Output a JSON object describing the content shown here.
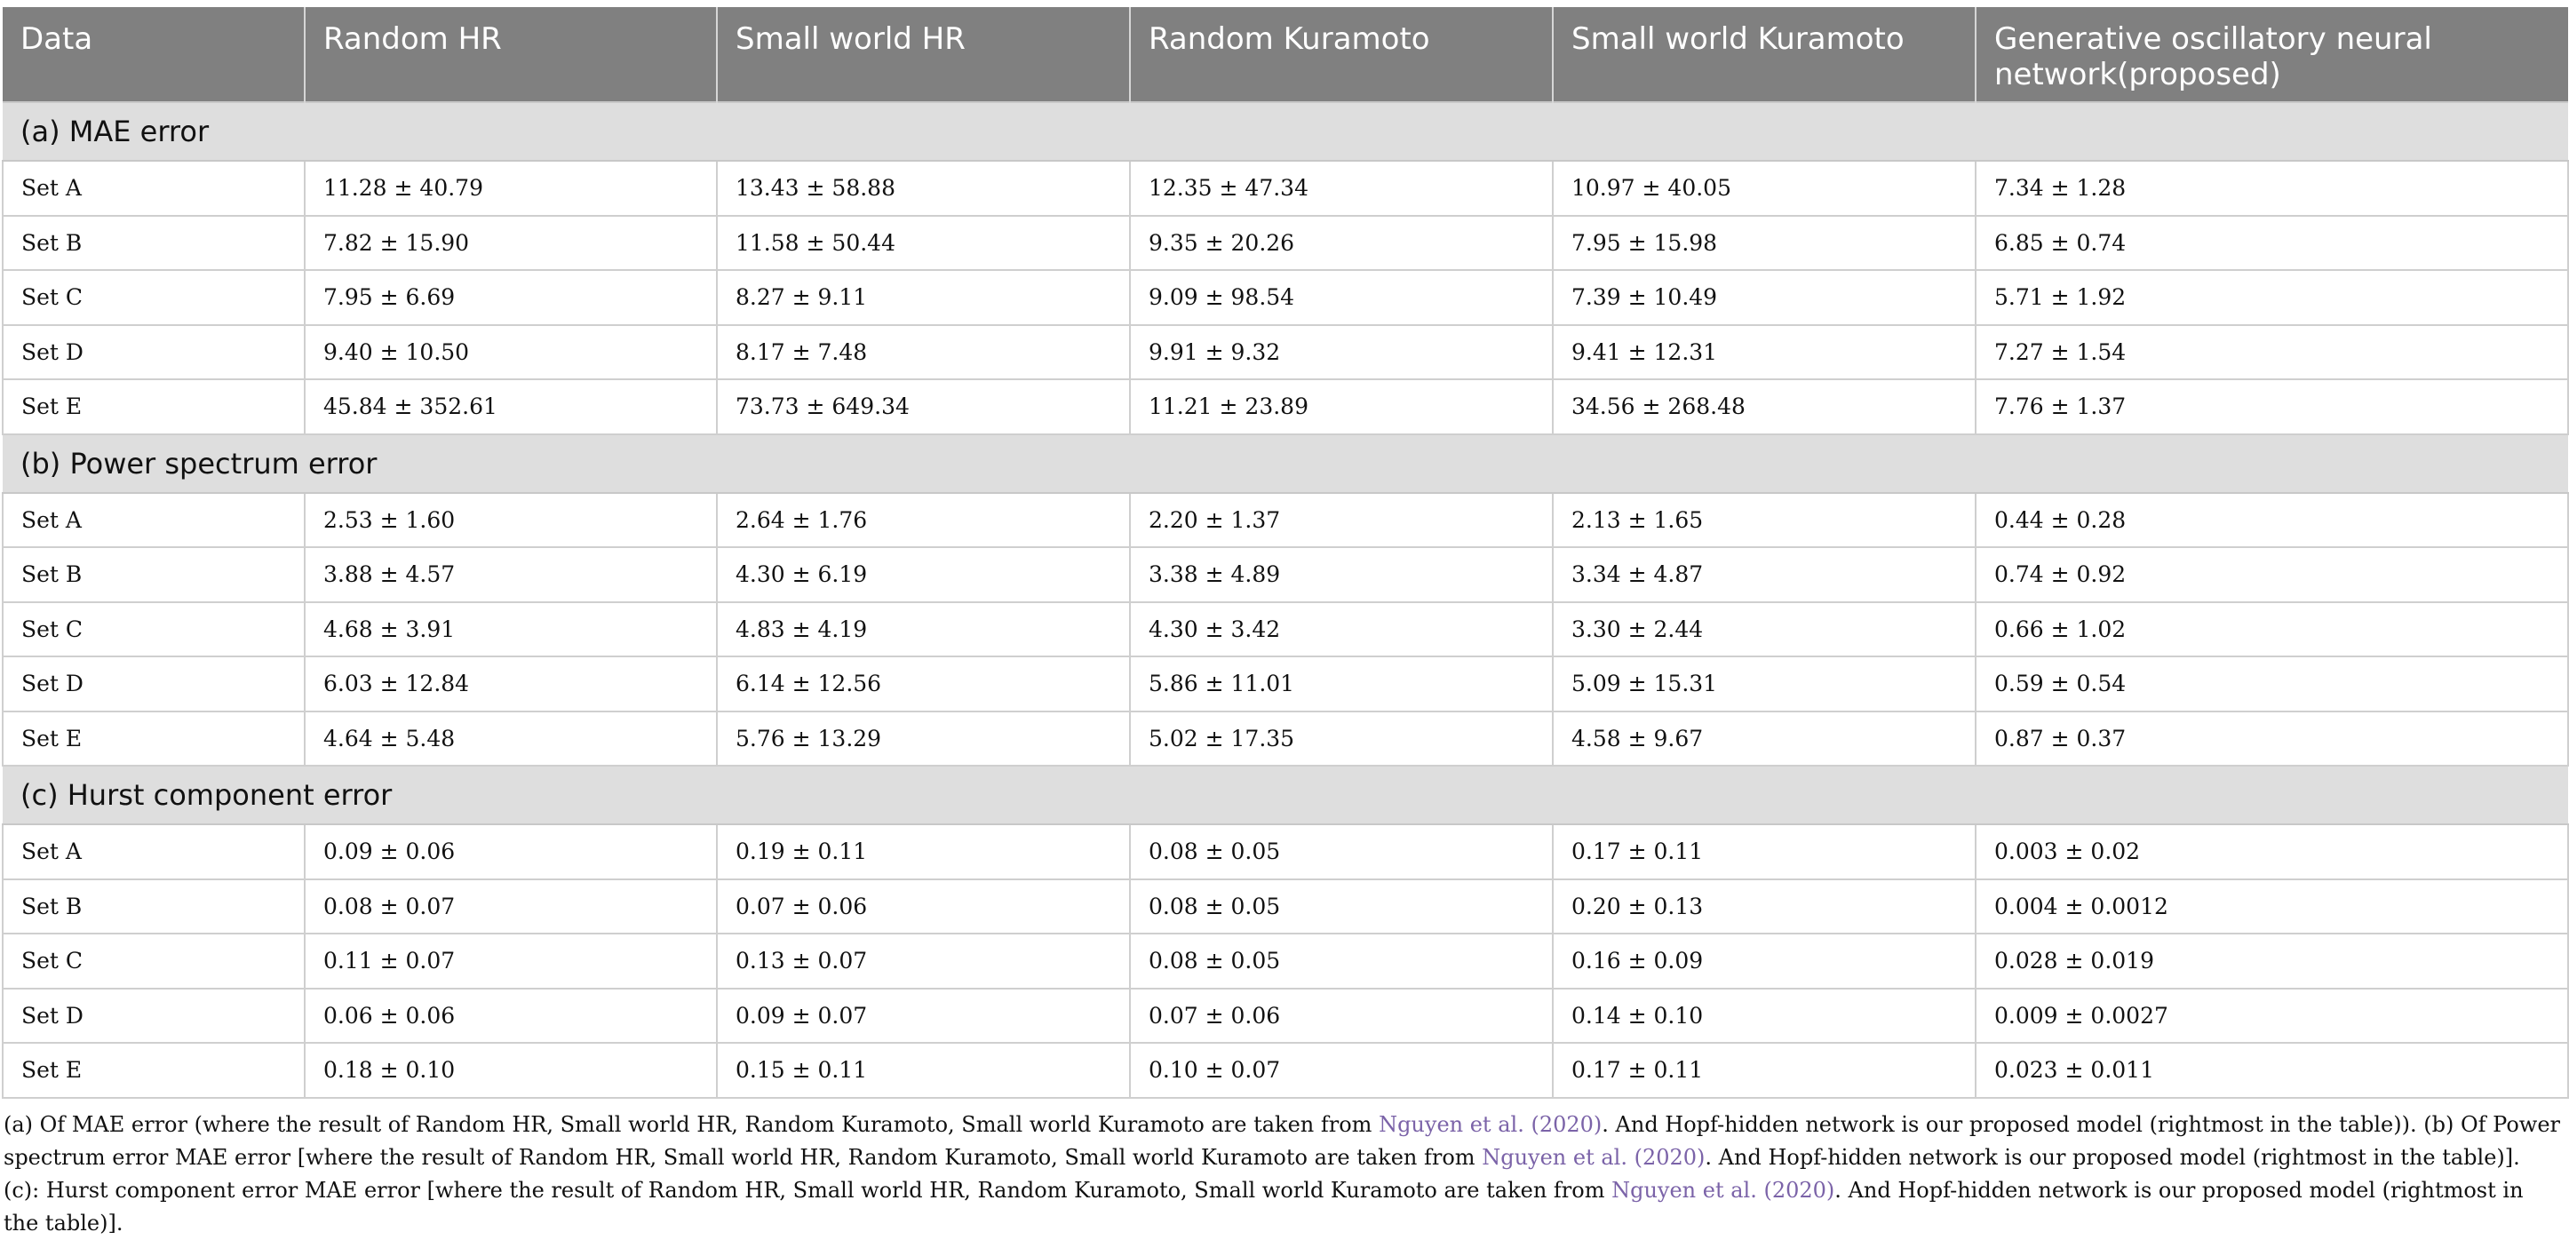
{
  "table": {
    "headers": [
      "Data",
      "Random HR",
      "Small world HR",
      "Random Kuramoto",
      "Small world Kuramoto",
      "Generative oscillatory neural network(proposed)"
    ],
    "sections": [
      {
        "title": "(a) MAE error",
        "rows": [
          [
            "Set A",
            "11.28 ± 40.79",
            "13.43 ± 58.88",
            "12.35 ± 47.34",
            "10.97 ± 40.05",
            "7.34 ± 1.28"
          ],
          [
            "Set B",
            "7.82 ± 15.90",
            "11.58 ± 50.44",
            "9.35 ± 20.26",
            "7.95 ± 15.98",
            "6.85 ± 0.74"
          ],
          [
            "Set C",
            "7.95 ± 6.69",
            "8.27 ± 9.11",
            "9.09 ± 98.54",
            "7.39 ± 10.49",
            "5.71 ± 1.92"
          ],
          [
            "Set D",
            "9.40 ± 10.50",
            "8.17 ± 7.48",
            "9.91 ± 9.32",
            "9.41 ± 12.31",
            "7.27 ± 1.54"
          ],
          [
            "Set E",
            "45.84 ± 352.61",
            "73.73 ± 649.34",
            "11.21 ± 23.89",
            "34.56 ± 268.48",
            "7.76 ± 1.37"
          ]
        ]
      },
      {
        "title": "(b) Power spectrum error",
        "rows": [
          [
            "Set A",
            "2.53 ± 1.60",
            "2.64 ± 1.76",
            "2.20 ± 1.37",
            "2.13 ± 1.65",
            "0.44 ± 0.28"
          ],
          [
            "Set B",
            "3.88 ± 4.57",
            "4.30 ± 6.19",
            "3.38 ± 4.89",
            "3.34 ± 4.87",
            "0.74 ± 0.92"
          ],
          [
            "Set C",
            "4.68 ± 3.91",
            "4.83 ± 4.19",
            "4.30 ± 3.42",
            "3.30 ± 2.44",
            "0.66 ± 1.02"
          ],
          [
            "Set D",
            "6.03 ± 12.84",
            "6.14 ± 12.56",
            "5.86 ± 11.01",
            "5.09 ± 15.31",
            "0.59 ± 0.54"
          ],
          [
            "Set E",
            "4.64 ± 5.48",
            "5.76 ± 13.29",
            "5.02 ± 17.35",
            "4.58 ± 9.67",
            "0.87 ± 0.37"
          ]
        ]
      },
      {
        "title": "(c) Hurst component error",
        "rows": [
          [
            "Set A",
            "0.09 ± 0.06",
            "0.19 ± 0.11",
            "0.08 ± 0.05",
            "0.17 ± 0.11",
            "0.003 ± 0.02"
          ],
          [
            "Set B",
            "0.08 ± 0.07",
            "0.07 ± 0.06",
            "0.08 ± 0.05",
            "0.20 ± 0.13",
            "0.004 ± 0.0012"
          ],
          [
            "Set C",
            "0.11 ± 0.07",
            "0.13 ± 0.07",
            "0.08 ± 0.05",
            "0.16 ± 0.09",
            "0.028 ± 0.019"
          ],
          [
            "Set D",
            "0.06 ± 0.06",
            "0.09 ± 0.07",
            "0.07 ± 0.06",
            "0.14 ± 0.10",
            "0.009 ± 0.0027"
          ],
          [
            "Set E",
            "0.18 ± 0.10",
            "0.15 ± 0.11",
            "0.10 ± 0.07",
            "0.17 ± 0.11",
            "0.023 ± 0.011"
          ]
        ]
      }
    ]
  },
  "footnote": {
    "part1": "(a) Of MAE error (where the result of Random HR, Small world HR, Random Kuramoto, Small world Kuramoto are taken from ",
    "ref1": "Nguyen et al. (2020)",
    "part2": ". And Hopf-hidden network is our proposed model (rightmost in the table)). (b) Of Power spectrum error MAE error [where the result of Random HR, Small world HR, Random Kuramoto, Small world Kuramoto are taken from ",
    "ref2": "Nguyen et al. (2020)",
    "part3": ". And Hopf-hidden network is our proposed model (rightmost in the table)]. (c): Hurst component error MAE error [where the result of Random HR, Small world HR, Random Kuramoto, Small world Kuramoto are taken from ",
    "ref3": "Nguyen et al. (2020)",
    "part4": ". And Hopf-hidden network is our proposed model (rightmost in the table)]."
  }
}
